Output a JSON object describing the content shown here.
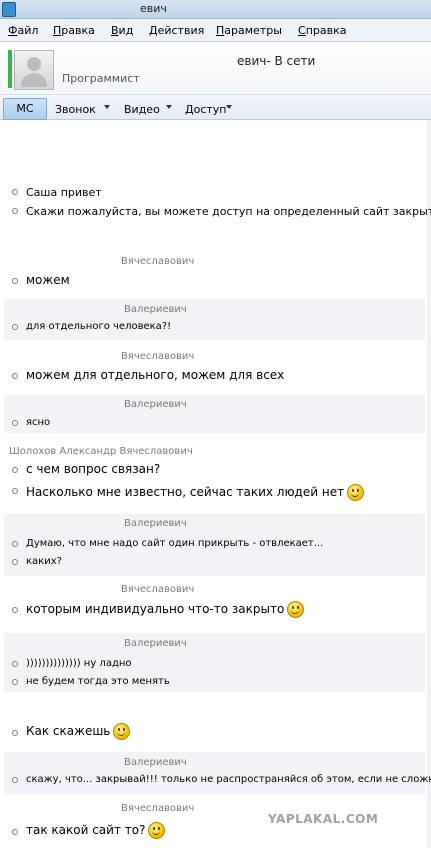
{
  "window": {
    "title": "евич"
  },
  "menu": [
    "Файл",
    "Правка",
    "Вид",
    "Действия",
    "Параметры",
    "Справка"
  ],
  "contact": {
    "status_line": "евич- В сети",
    "job": "Программист",
    "presence_color": "#39b54a"
  },
  "toolbar": {
    "im_label": "МС",
    "call_label": "Звонок",
    "video_label": "Видео",
    "access_label": "Доступ"
  },
  "messages": {
    "m1": "Саша привет",
    "m2": "Скажи пожалуйста, вы можете доступ на определенный сайт закрыть?",
    "s3": "Вячеславович",
    "m3": "можем",
    "s4": "Валериевич",
    "m4": "для отдельного человека?!",
    "s5": "Вячеславович",
    "m5": "можем для отдельного, можем для всех",
    "s6": "Валериевич",
    "m6": "ясно",
    "s7": "Шолохов Александр Вячеславович",
    "m7a": "с чем вопрос связан?",
    "m7b": "Насколько мне известно, сейчас таких людей нет",
    "s8": "Валериевич",
    "m8a": "Думаю, что мне надо сайт один прикрыть - отвлекает...",
    "m8b": "каких?",
    "s9": "Вячеславович",
    "m9": "которым индивидуально что-то закрыто",
    "s10": "Валериевич",
    "m10a": ")))))))))))))) ну ладно",
    "m10b": "не будем тогда это менять",
    "m11": "Как скажешь",
    "s12": "Валериевич",
    "m12": "скажу, что... закрывай!!! только не распространяйся об этом, если не сложно",
    "s13": "Вячеславович",
    "m13": "так какой сайт то?"
  },
  "watermark": "YAPLAKAL.COM"
}
